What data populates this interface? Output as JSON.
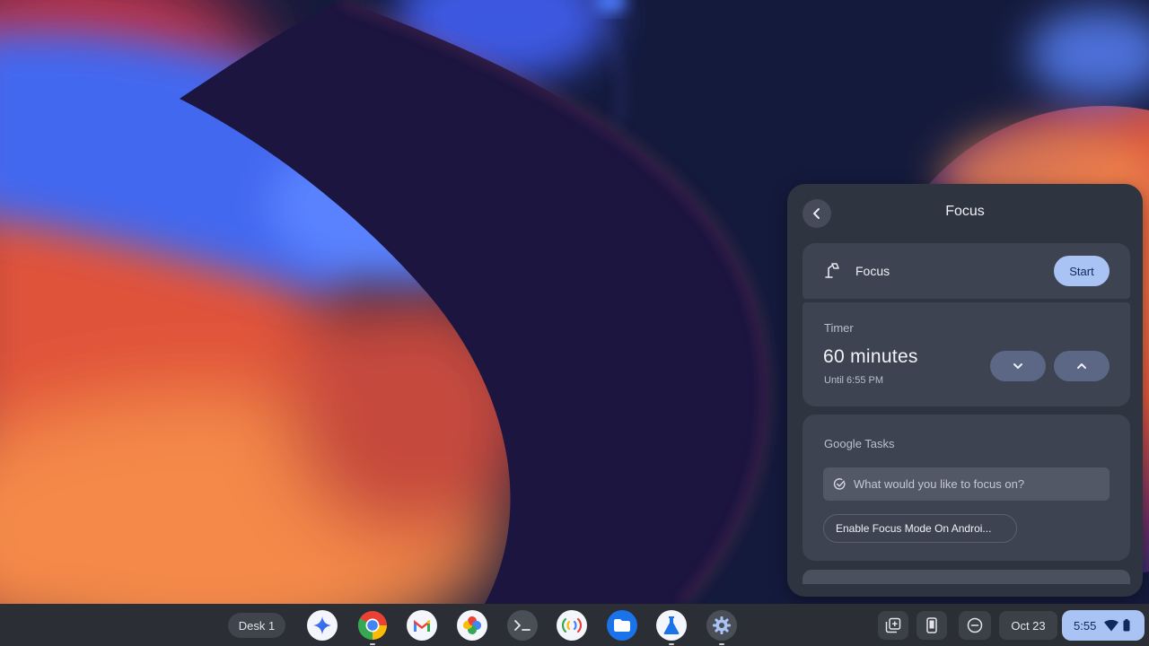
{
  "panel": {
    "title": "Focus",
    "focus_row": {
      "label": "Focus",
      "start_label": "Start"
    },
    "timer": {
      "label": "Timer",
      "value": "60 minutes",
      "until": "Until 6:55 PM"
    },
    "tasks": {
      "label": "Google Tasks",
      "placeholder": "What would you like to focus on?",
      "chip_label": "Enable Focus Mode On Androi..."
    }
  },
  "shelf": {
    "desk_label": "Desk 1",
    "apps": [
      {
        "name": "gemini-app",
        "icon": "sparkle-icon"
      },
      {
        "name": "chrome-app",
        "icon": "chrome-icon"
      },
      {
        "name": "gmail-app",
        "icon": "gmail-icon"
      },
      {
        "name": "photos-app",
        "icon": "photos-icon"
      },
      {
        "name": "terminal-app",
        "icon": "terminal-icon"
      },
      {
        "name": "nearby-app",
        "icon": "nearby-icon"
      },
      {
        "name": "files-app",
        "icon": "folder-icon"
      },
      {
        "name": "labs-app",
        "icon": "flask-icon"
      },
      {
        "name": "settings-app",
        "icon": "gear-icon"
      }
    ],
    "tray": {
      "date": "Oct 23",
      "time": "5:55"
    }
  },
  "colors": {
    "accent": "#a9c3f5",
    "panel_bg": "#2e3440",
    "card_bg": "#3d4350",
    "shelf_bg": "#2b2e34"
  }
}
